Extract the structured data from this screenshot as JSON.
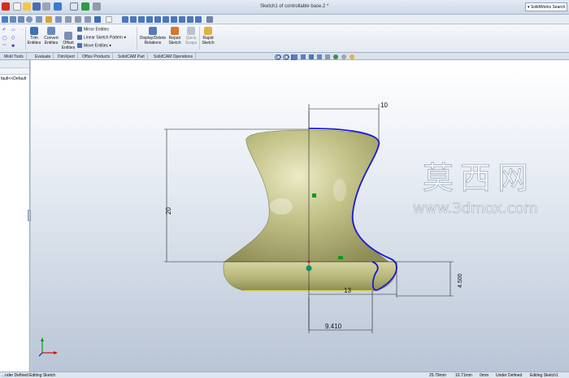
{
  "window": {
    "title": "Sketch1 of controllable base.2 *",
    "search_placeholder": "SolidWorks Search"
  },
  "ribbon": {
    "trim_label": "Trim\nEntities",
    "convert_label": "Convert\nEntities",
    "offset_label": "Offset\nEntities",
    "mirror_label": "Mirror Entities",
    "linear_pattern_label": "Linear Sketch Pattern",
    "move_label": "Move Entities",
    "relations_label": "Display/Delete\nRelations",
    "repair_label": "Repair\nSketch",
    "quick_snaps_label": "Quick\nSnaps",
    "rapid_sketch_label": "Rapid\nSketch"
  },
  "tabs": [
    "Mold Tools",
    "Evaluate",
    "DimXpert",
    "Office Products",
    "SolidCAM Part",
    "SolidCAM Operations"
  ],
  "tree": {
    "item": "fault<<Default"
  },
  "dimensions": {
    "top_width": "10",
    "height": "20",
    "base_width": "13",
    "base_height": "4.500",
    "bottom_width": "9.410"
  },
  "watermark": {
    "cn": "莫西网",
    "url": "www.3dmox.com"
  },
  "status": {
    "left": "...nder Defined  Editing Sketch",
    "x": "25.79mm",
    "y": "10.71mm",
    "z": "0mm",
    "defined": "Under Defined",
    "editing": "Editing Sketch1"
  },
  "colors": {
    "body_fill": "#b8b77a",
    "sketch_curve": "#1a1ad0",
    "dimension_line": "#222222",
    "axis_green": "#0a9a1a",
    "axis_red": "#d01010",
    "axis_blue": "#1010d0"
  }
}
